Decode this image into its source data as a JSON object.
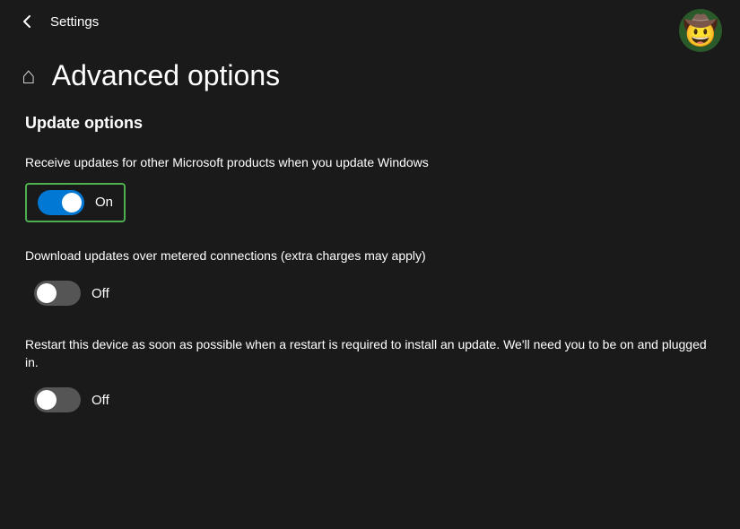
{
  "header": {
    "title": "Settings",
    "back_label": "←"
  },
  "page": {
    "title": "Advanced options",
    "home_icon": "⌂"
  },
  "sections": [
    {
      "title": "Update options",
      "settings": [
        {
          "id": "microsoft-products",
          "description": "Receive updates for other Microsoft products when you update Windows",
          "state": "on",
          "state_label": "On",
          "highlighted": true
        },
        {
          "id": "metered-connections",
          "description": "Download updates over metered connections (extra charges may apply)",
          "state": "off",
          "state_label": "Off",
          "highlighted": false
        },
        {
          "id": "restart-device",
          "description": "Restart this device as soon as possible when a restart is required to install an update. We'll need you to be on and plugged in.",
          "state": "off",
          "state_label": "Off",
          "highlighted": false
        }
      ]
    }
  ]
}
